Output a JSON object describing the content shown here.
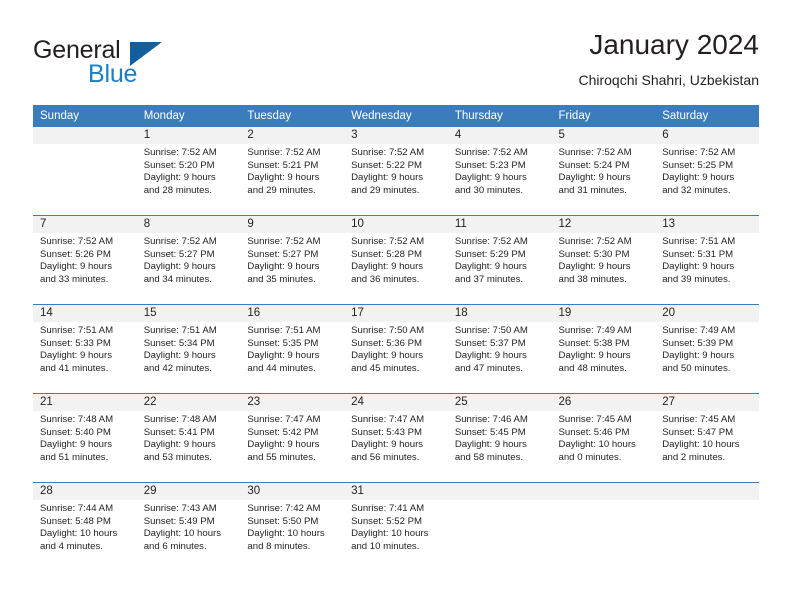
{
  "brand": {
    "name_part1": "General",
    "name_part2": "Blue",
    "logo_icon": "triangle-logo-icon",
    "accent_color": "#1c7fc4",
    "logo_color": "#135f9e"
  },
  "header": {
    "title": "January 2024",
    "subtitle": "Chiroqchi Shahri, Uzbekistan"
  },
  "calendar": {
    "header_bg_color": "#3a7cbc",
    "daynum_band_color": "#f2f2f2",
    "weekdays": [
      "Sunday",
      "Monday",
      "Tuesday",
      "Wednesday",
      "Thursday",
      "Friday",
      "Saturday"
    ],
    "weeks": [
      [
        {
          "day": "",
          "sunrise": "",
          "sunset": "",
          "daylight1": "",
          "daylight2": ""
        },
        {
          "day": "1",
          "sunrise": "Sunrise: 7:52 AM",
          "sunset": "Sunset: 5:20 PM",
          "daylight1": "Daylight: 9 hours",
          "daylight2": "and 28 minutes."
        },
        {
          "day": "2",
          "sunrise": "Sunrise: 7:52 AM",
          "sunset": "Sunset: 5:21 PM",
          "daylight1": "Daylight: 9 hours",
          "daylight2": "and 29 minutes."
        },
        {
          "day": "3",
          "sunrise": "Sunrise: 7:52 AM",
          "sunset": "Sunset: 5:22 PM",
          "daylight1": "Daylight: 9 hours",
          "daylight2": "and 29 minutes."
        },
        {
          "day": "4",
          "sunrise": "Sunrise: 7:52 AM",
          "sunset": "Sunset: 5:23 PM",
          "daylight1": "Daylight: 9 hours",
          "daylight2": "and 30 minutes."
        },
        {
          "day": "5",
          "sunrise": "Sunrise: 7:52 AM",
          "sunset": "Sunset: 5:24 PM",
          "daylight1": "Daylight: 9 hours",
          "daylight2": "and 31 minutes."
        },
        {
          "day": "6",
          "sunrise": "Sunrise: 7:52 AM",
          "sunset": "Sunset: 5:25 PM",
          "daylight1": "Daylight: 9 hours",
          "daylight2": "and 32 minutes."
        }
      ],
      [
        {
          "day": "7",
          "sunrise": "Sunrise: 7:52 AM",
          "sunset": "Sunset: 5:26 PM",
          "daylight1": "Daylight: 9 hours",
          "daylight2": "and 33 minutes."
        },
        {
          "day": "8",
          "sunrise": "Sunrise: 7:52 AM",
          "sunset": "Sunset: 5:27 PM",
          "daylight1": "Daylight: 9 hours",
          "daylight2": "and 34 minutes."
        },
        {
          "day": "9",
          "sunrise": "Sunrise: 7:52 AM",
          "sunset": "Sunset: 5:27 PM",
          "daylight1": "Daylight: 9 hours",
          "daylight2": "and 35 minutes."
        },
        {
          "day": "10",
          "sunrise": "Sunrise: 7:52 AM",
          "sunset": "Sunset: 5:28 PM",
          "daylight1": "Daylight: 9 hours",
          "daylight2": "and 36 minutes."
        },
        {
          "day": "11",
          "sunrise": "Sunrise: 7:52 AM",
          "sunset": "Sunset: 5:29 PM",
          "daylight1": "Daylight: 9 hours",
          "daylight2": "and 37 minutes."
        },
        {
          "day": "12",
          "sunrise": "Sunrise: 7:52 AM",
          "sunset": "Sunset: 5:30 PM",
          "daylight1": "Daylight: 9 hours",
          "daylight2": "and 38 minutes."
        },
        {
          "day": "13",
          "sunrise": "Sunrise: 7:51 AM",
          "sunset": "Sunset: 5:31 PM",
          "daylight1": "Daylight: 9 hours",
          "daylight2": "and 39 minutes."
        }
      ],
      [
        {
          "day": "14",
          "sunrise": "Sunrise: 7:51 AM",
          "sunset": "Sunset: 5:33 PM",
          "daylight1": "Daylight: 9 hours",
          "daylight2": "and 41 minutes."
        },
        {
          "day": "15",
          "sunrise": "Sunrise: 7:51 AM",
          "sunset": "Sunset: 5:34 PM",
          "daylight1": "Daylight: 9 hours",
          "daylight2": "and 42 minutes."
        },
        {
          "day": "16",
          "sunrise": "Sunrise: 7:51 AM",
          "sunset": "Sunset: 5:35 PM",
          "daylight1": "Daylight: 9 hours",
          "daylight2": "and 44 minutes."
        },
        {
          "day": "17",
          "sunrise": "Sunrise: 7:50 AM",
          "sunset": "Sunset: 5:36 PM",
          "daylight1": "Daylight: 9 hours",
          "daylight2": "and 45 minutes."
        },
        {
          "day": "18",
          "sunrise": "Sunrise: 7:50 AM",
          "sunset": "Sunset: 5:37 PM",
          "daylight1": "Daylight: 9 hours",
          "daylight2": "and 47 minutes."
        },
        {
          "day": "19",
          "sunrise": "Sunrise: 7:49 AM",
          "sunset": "Sunset: 5:38 PM",
          "daylight1": "Daylight: 9 hours",
          "daylight2": "and 48 minutes."
        },
        {
          "day": "20",
          "sunrise": "Sunrise: 7:49 AM",
          "sunset": "Sunset: 5:39 PM",
          "daylight1": "Daylight: 9 hours",
          "daylight2": "and 50 minutes."
        }
      ],
      [
        {
          "day": "21",
          "sunrise": "Sunrise: 7:48 AM",
          "sunset": "Sunset: 5:40 PM",
          "daylight1": "Daylight: 9 hours",
          "daylight2": "and 51 minutes."
        },
        {
          "day": "22",
          "sunrise": "Sunrise: 7:48 AM",
          "sunset": "Sunset: 5:41 PM",
          "daylight1": "Daylight: 9 hours",
          "daylight2": "and 53 minutes."
        },
        {
          "day": "23",
          "sunrise": "Sunrise: 7:47 AM",
          "sunset": "Sunset: 5:42 PM",
          "daylight1": "Daylight: 9 hours",
          "daylight2": "and 55 minutes."
        },
        {
          "day": "24",
          "sunrise": "Sunrise: 7:47 AM",
          "sunset": "Sunset: 5:43 PM",
          "daylight1": "Daylight: 9 hours",
          "daylight2": "and 56 minutes."
        },
        {
          "day": "25",
          "sunrise": "Sunrise: 7:46 AM",
          "sunset": "Sunset: 5:45 PM",
          "daylight1": "Daylight: 9 hours",
          "daylight2": "and 58 minutes."
        },
        {
          "day": "26",
          "sunrise": "Sunrise: 7:45 AM",
          "sunset": "Sunset: 5:46 PM",
          "daylight1": "Daylight: 10 hours",
          "daylight2": "and 0 minutes."
        },
        {
          "day": "27",
          "sunrise": "Sunrise: 7:45 AM",
          "sunset": "Sunset: 5:47 PM",
          "daylight1": "Daylight: 10 hours",
          "daylight2": "and 2 minutes."
        }
      ],
      [
        {
          "day": "28",
          "sunrise": "Sunrise: 7:44 AM",
          "sunset": "Sunset: 5:48 PM",
          "daylight1": "Daylight: 10 hours",
          "daylight2": "and 4 minutes."
        },
        {
          "day": "29",
          "sunrise": "Sunrise: 7:43 AM",
          "sunset": "Sunset: 5:49 PM",
          "daylight1": "Daylight: 10 hours",
          "daylight2": "and 6 minutes."
        },
        {
          "day": "30",
          "sunrise": "Sunrise: 7:42 AM",
          "sunset": "Sunset: 5:50 PM",
          "daylight1": "Daylight: 10 hours",
          "daylight2": "and 8 minutes."
        },
        {
          "day": "31",
          "sunrise": "Sunrise: 7:41 AM",
          "sunset": "Sunset: 5:52 PM",
          "daylight1": "Daylight: 10 hours",
          "daylight2": "and 10 minutes."
        },
        {
          "day": "",
          "sunrise": "",
          "sunset": "",
          "daylight1": "",
          "daylight2": ""
        },
        {
          "day": "",
          "sunrise": "",
          "sunset": "",
          "daylight1": "",
          "daylight2": ""
        },
        {
          "day": "",
          "sunrise": "",
          "sunset": "",
          "daylight1": "",
          "daylight2": ""
        }
      ]
    ]
  }
}
